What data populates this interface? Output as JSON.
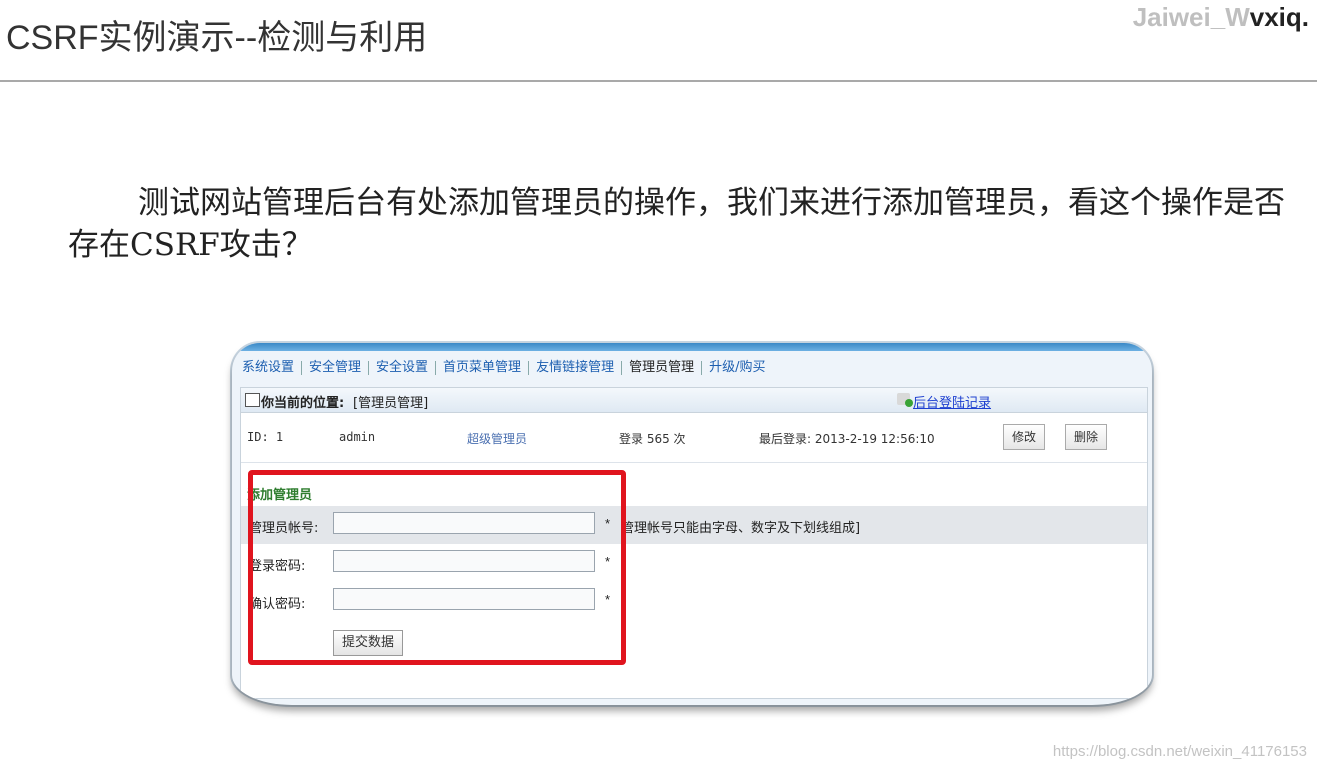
{
  "slide": {
    "title": "CSRF实例演示--检测与利用",
    "watermark_top": "Jaiwei_W",
    "watermark_top_dark": "vxiq.",
    "paragraph": "测试网站管理后台有处添加管理员的操作，我们来进行添加管理员，看这个操作是否存在CSRF攻击？",
    "watermark_bottom": "https://blog.csdn.net/weixin_41176153"
  },
  "nav": {
    "items": [
      "系统设置",
      "安全管理",
      "安全设置",
      "首页菜单管理",
      "友情链接管理",
      "管理员管理",
      "升级/购买"
    ]
  },
  "location": {
    "label": "你当前的位置:",
    "value": "[管理员管理]",
    "login_records": "后台登陆记录"
  },
  "admin_row": {
    "id": "ID: 1",
    "username": "admin",
    "role": "超级管理员",
    "login_count": "登录 565 次",
    "last_login": "最后登录: 2013-2-19 12:56:10",
    "edit_label": "修改",
    "delete_label": "删除"
  },
  "add_admin": {
    "title": "添加管理员",
    "account_label": "管理员帐号:",
    "account_value": "",
    "account_hint": "管理帐号只能由字母、数字及下划线组成]",
    "password_label": "登录密码:",
    "password_value": "",
    "confirm_label": "确认密码:",
    "confirm_value": "",
    "required_mark": "*",
    "submit_label": "提交数据"
  },
  "colors": {
    "highlight": "#e0141e",
    "link": "#1d5fb0",
    "section_title": "#2e7d2e"
  }
}
